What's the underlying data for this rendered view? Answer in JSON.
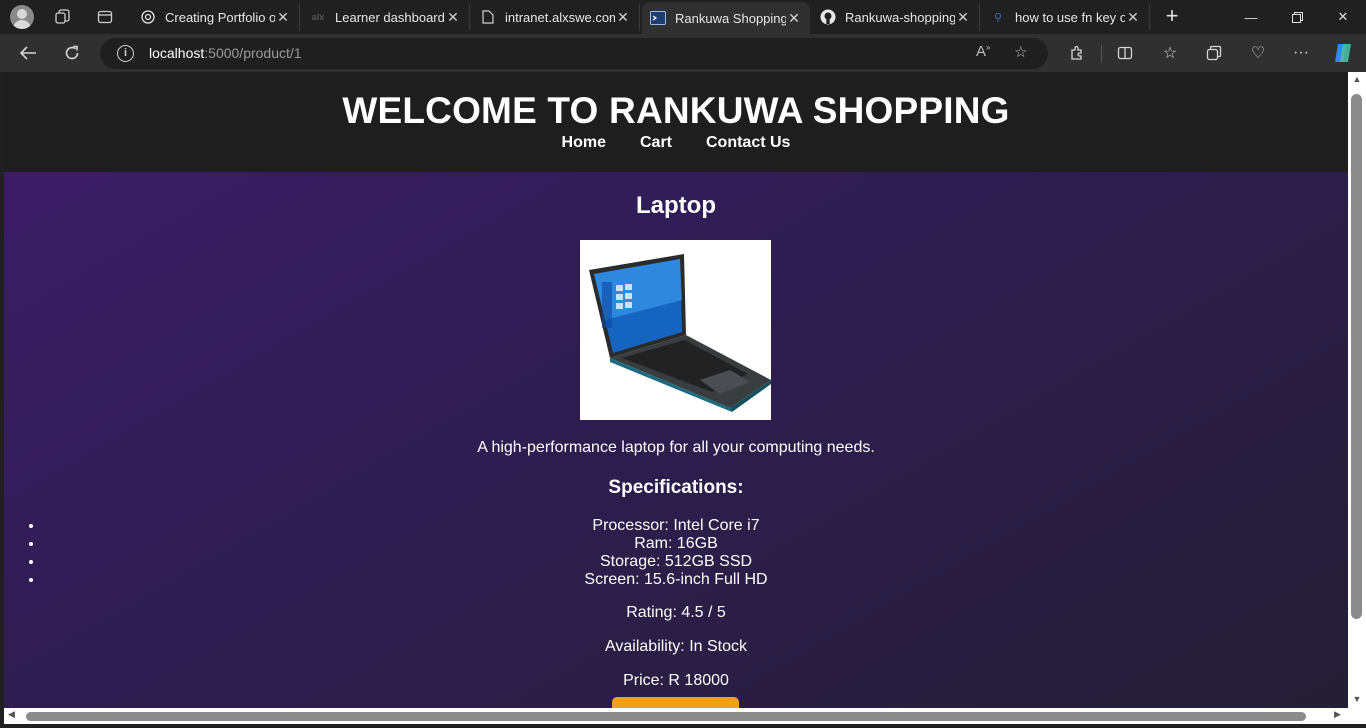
{
  "browser": {
    "tabs": [
      {
        "title": "Creating Portfolio on",
        "favicon": "chatgpt-icon",
        "active": false
      },
      {
        "title": "Learner dashboard |",
        "favicon": "alx-icon",
        "active": false
      },
      {
        "title": "intranet.alxswe.com",
        "favicon": "document-icon",
        "active": false
      },
      {
        "title": "Rankuwa Shopping",
        "favicon": "terminal-icon",
        "active": true
      },
      {
        "title": "Rankuwa-shopping/",
        "favicon": "github-icon",
        "active": false
      },
      {
        "title": "how to use fn key on",
        "favicon": "search-icon",
        "active": false
      }
    ],
    "address": {
      "host": "localhost",
      "path": ":5000/product/1"
    }
  },
  "site": {
    "title": "WELCOME TO RANKUWA SHOPPING",
    "nav": [
      "Home",
      "Cart",
      "Contact Us"
    ]
  },
  "product": {
    "name": "Laptop",
    "image_alt": "laptop-image",
    "description": "A high-performance laptop for all your computing needs.",
    "specs_heading": "Specifications:",
    "specs": [
      "Processor: Intel Core i7",
      "Ram: 16GB",
      "Storage: 512GB SSD",
      "Screen: 15.6-inch Full HD"
    ],
    "rating": "Rating: 4.5 / 5",
    "availability": "Availability: In Stock",
    "price": "Price: R 18000"
  },
  "colors": {
    "header_bg": "#1e1e1e",
    "content_gradient_start": "#3b1d66",
    "content_gradient_end": "#251f35",
    "buy_button": "#f0a01c"
  }
}
